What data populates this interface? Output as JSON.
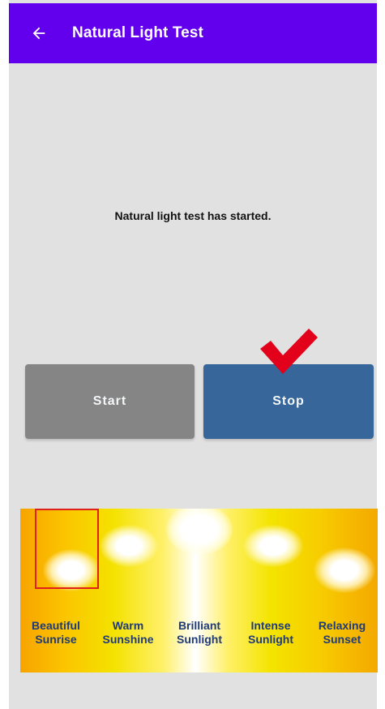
{
  "header": {
    "title": "Natural Light Test",
    "back_icon": "back-arrow-icon"
  },
  "status_message": "Natural light test has started.",
  "buttons": {
    "start_label": "Start",
    "stop_label": "Stop"
  },
  "selected_indicator_icon": "checkmark-icon",
  "light_modes": [
    {
      "line1": "Beautiful",
      "line2": "Sunrise",
      "selected": true
    },
    {
      "line1": "Warm",
      "line2": "Sunshine",
      "selected": false
    },
    {
      "line1": "Brilliant",
      "line2": "Sunlight",
      "selected": false
    },
    {
      "line1": "Intense",
      "line2": "Sunlight",
      "selected": false
    },
    {
      "line1": "Relaxing",
      "line2": "Sunset",
      "selected": false
    }
  ],
  "colors": {
    "app_bar": "#6200ee",
    "start_button": "#858585",
    "stop_button": "#37679a",
    "checkmark": "#e2001a",
    "selection_box": "#e0201a",
    "mode_label": "#1f3a7a"
  }
}
